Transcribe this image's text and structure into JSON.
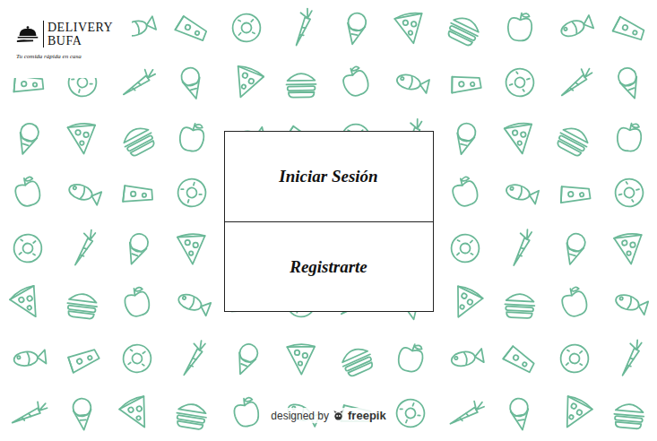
{
  "logo": {
    "name_line1": "DELIVERY",
    "name_line2": "BUFA",
    "tagline": "Tu comida rápida en casa"
  },
  "auth_buttons": [
    {
      "label": "Iniciar Sesión"
    },
    {
      "label": "Registrarte"
    }
  ],
  "credit": {
    "prefix": "designed by",
    "brand": "freepik"
  }
}
